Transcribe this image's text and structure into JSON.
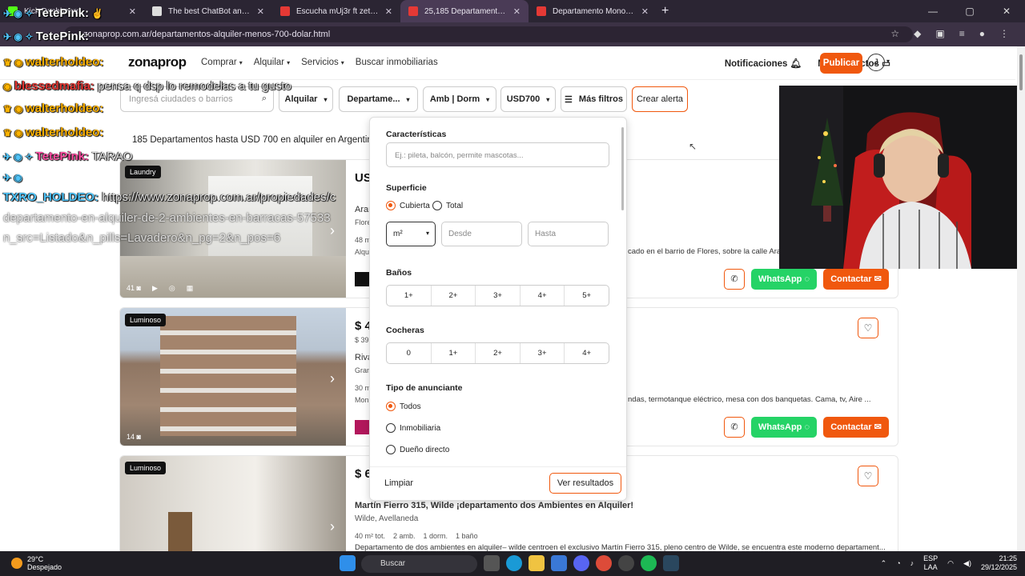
{
  "browser": {
    "tabs": [
      {
        "title": "Kick Dashboard",
        "color": "#53fc18"
      },
      {
        "title": "The best ChatBot and Widgets",
        "color": "#dddddd"
      },
      {
        "title": "Escucha mUj3r ft zetkAww de g",
        "color": "#e53935"
      },
      {
        "title": "25,185 Departamentos hasta U",
        "color": "#e53935"
      },
      {
        "title": "Departamento Monoambiente",
        "color": "#e53935"
      }
    ],
    "url": "zonaprop.com.ar/departamentos-alquiler-menos-700-dolar.html",
    "window_controls": [
      "—",
      "▢",
      "✕"
    ]
  },
  "site": {
    "logo": "zonaprop",
    "nav": [
      "Comprar",
      "Alquilar",
      "Servicios",
      "Buscar inmobiliarias"
    ],
    "notifications": "Notificaciones",
    "contacts": "Mis contactos",
    "publish": "Publicar",
    "avatar_initial": "J"
  },
  "filters": {
    "search_placeholder": "Ingresá ciudades o barrios",
    "operation": "Alquilar",
    "property_type": "Departame...",
    "rooms": "Amb | Dorm",
    "price": "USD700",
    "more": "Más filtros",
    "alert": "Crear alerta"
  },
  "results_heading": "185 Departamentos hasta USD 700 en alquiler en Argentina",
  "listings": [
    {
      "badge": "Laundry",
      "photos": "41",
      "price": "US",
      "price_sub": "",
      "title": "Aran",
      "location": "Flore",
      "features": "48 m",
      "description": "Alqu",
      "description_right": "cado en el barrio de Flores, sobre la calle Arangu",
      "whatsapp": "WhatsApp",
      "contact": "Contactar"
    },
    {
      "badge": "Luminoso",
      "photos": "14",
      "price": "$ 4",
      "price_sub": "$ 39.",
      "title": "Riva",
      "location": "Gran",
      "features": "30 m",
      "description": "Mon",
      "description_right": "ndas, termotanque eléctrico, mesa con dos banquetas. Cama, tv, Aire ...",
      "whatsapp": "WhatsApp",
      "contact": "Contactar"
    },
    {
      "badge": "Luminoso",
      "photos": "",
      "price": "$ 6",
      "title": "Martín Fierro 315, Wilde ¡departamento dos Ambientes en Alquiler!",
      "location": "Wilde, Avellaneda",
      "features": "40 m² tot.    2 amb.    1 dorm.    1 baño",
      "description": "Departamento de dos ambientes en alquiler– wilde centroen el exclusivo Martín Fierro 315, pleno centro de Wilde, se encuentra este moderno departament..."
    }
  ],
  "panel": {
    "caracteristicas": "Características",
    "caracteristicas_placeholder": "Ej.: pileta, balcón, permite mascotas...",
    "superficie": "Superficie",
    "cubierta": "Cubierta",
    "total": "Total",
    "unit": "m²",
    "desde": "Desde",
    "hasta": "Hasta",
    "banos": "Baños",
    "banos_opts": [
      "1+",
      "2+",
      "3+",
      "4+",
      "5+"
    ],
    "cocheras": "Cocheras",
    "cocheras_opts": [
      "0",
      "1+",
      "2+",
      "3+",
      "4+"
    ],
    "anunciante": "Tipo de anunciante",
    "anunciante_opts": [
      "Todos",
      "Inmobiliaria",
      "Dueño directo"
    ],
    "limpiar": "Limpiar",
    "ver_resultados": "Ver resultados"
  },
  "chat": [
    {
      "user": "TetePink:",
      "msg": "",
      "color": "#ffffff"
    },
    {
      "user": "TetePink:",
      "msg": "",
      "color": "#ffffff"
    },
    {
      "user": "walterholdeo:",
      "msg": "",
      "color": "#ffb300"
    },
    {
      "user": "blessedmafia:",
      "msg": " pensa q dsp lo remodelas a tu gusto",
      "color": "#e53935"
    },
    {
      "user": "walterholdeo:",
      "msg": "",
      "color": "#ffb300"
    },
    {
      "user": "walterholdeo:",
      "msg": "",
      "color": "#ffb300"
    },
    {
      "user": "TetePink:",
      "msg": " TARAO",
      "color": "#ff4fa3"
    },
    {
      "user": "TXRO_HOLDEO:",
      "msg": " https://www.zonaprop.com.ar/propiedades/c",
      "color": "#4fc3f7"
    }
  ],
  "chat_extra": [
    "departamento-en-alquiler-de-2-ambientes-en-barracas-57533",
    "n_src=Listado&n_pills=Lavadero&n_pg=2&n_pos=6"
  ],
  "taskbar": {
    "temp": "29°C",
    "weather": "Despejado",
    "search": "Buscar",
    "lang1": "ESP",
    "lang2": "LAA",
    "time": "21:25",
    "date": "29/12/2025"
  },
  "colors": {
    "accent": "#f0580e",
    "whatsapp": "#25d366"
  }
}
